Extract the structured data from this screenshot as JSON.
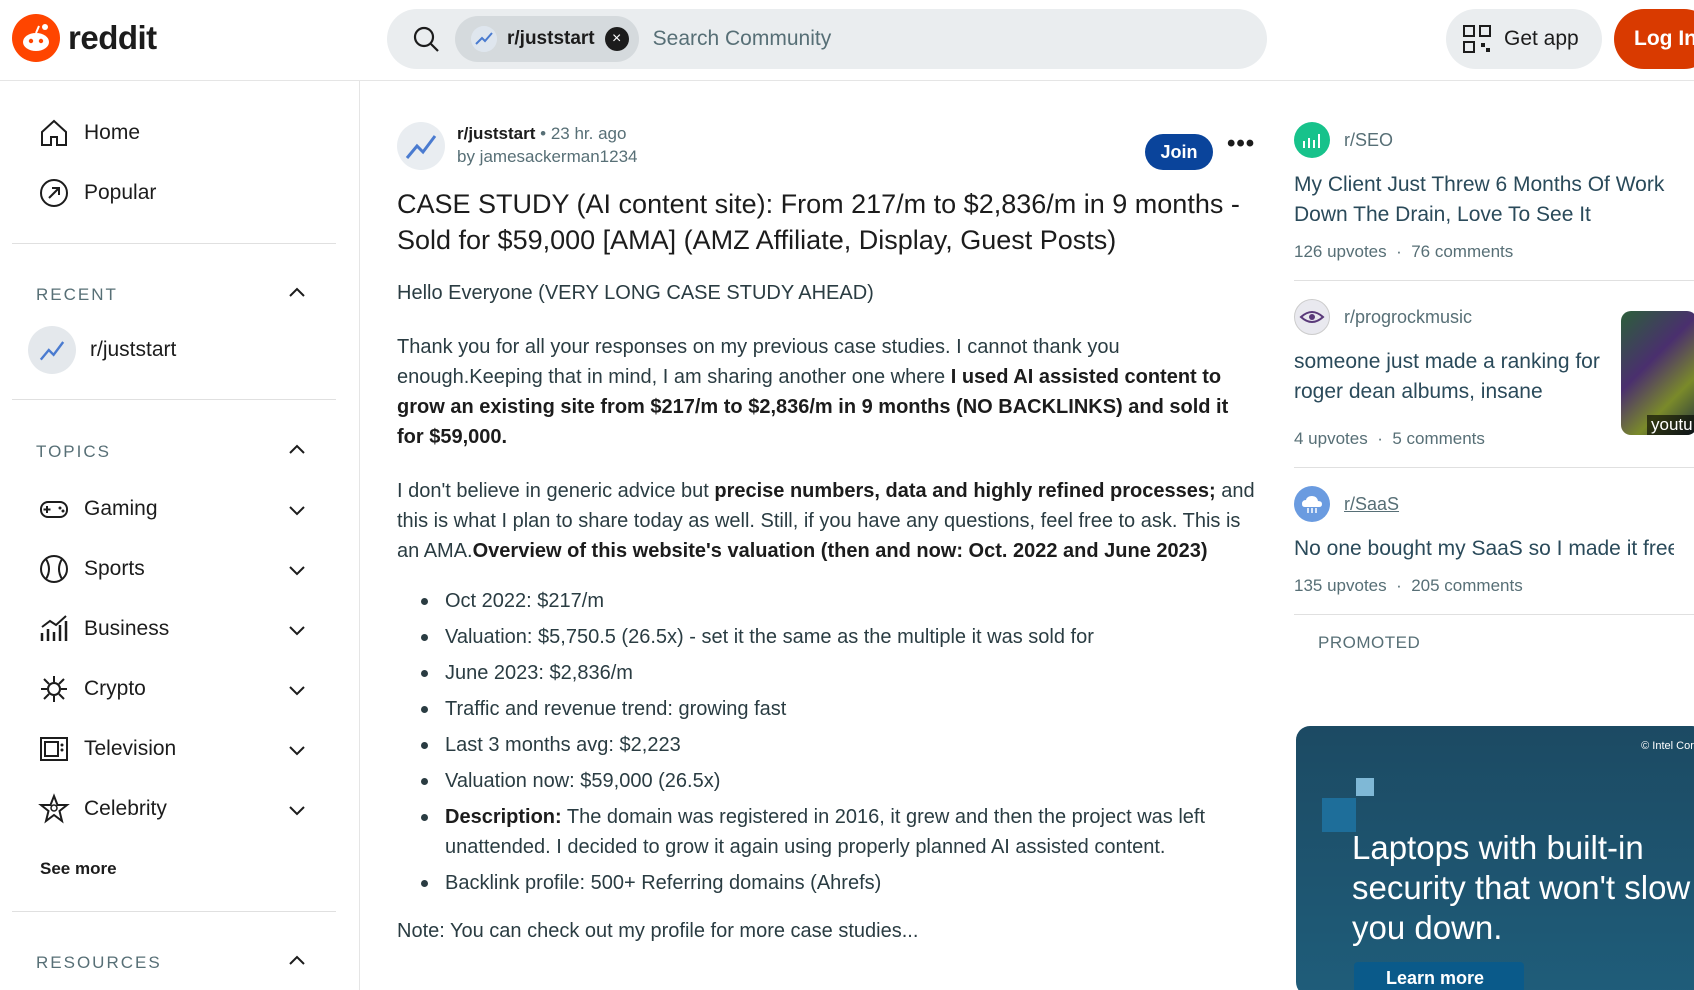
{
  "header": {
    "logo_text": "reddit",
    "search": {
      "chip_label": "r/juststart",
      "placeholder": "Search Community"
    },
    "get_app_label": "Get app",
    "login_label": "Log In"
  },
  "sidebar": {
    "nav": [
      {
        "label": "Home",
        "icon": "home-icon"
      },
      {
        "label": "Popular",
        "icon": "popular-icon"
      }
    ],
    "recent": {
      "title": "RECENT",
      "items": [
        {
          "label": "r/juststart"
        }
      ]
    },
    "topics": {
      "title": "TOPICS",
      "items": [
        {
          "label": "Gaming",
          "icon": "gamepad-icon"
        },
        {
          "label": "Sports",
          "icon": "sports-icon"
        },
        {
          "label": "Business",
          "icon": "business-chart-icon"
        },
        {
          "label": "Crypto",
          "icon": "crypto-icon"
        },
        {
          "label": "Television",
          "icon": "television-icon"
        },
        {
          "label": "Celebrity",
          "icon": "celebrity-star-icon"
        }
      ],
      "see_more": "See more"
    },
    "resources": {
      "title": "RESOURCES"
    }
  },
  "post": {
    "subreddit": "r/juststart",
    "time": "• 23 hr. ago",
    "author": "by jamesackerman1234",
    "join_label": "Join",
    "more_label": "•••",
    "title": "CASE STUDY (AI content site): From 217/m to $2,836/m in 9 months - Sold for $59,000 [AMA] (AMZ Affiliate, Display, Guest Posts)",
    "intro": "Hello Everyone (VERY LONG CASE STUDY AHEAD)",
    "p1_plain": "Thank you for all your responses on my previous case studies. I cannot thank you enough.Keeping that in mind, I am sharing another one where ",
    "p1_bold": "I used AI assisted content to grow an existing site from $217/m to $2,836/m in 9 months (NO BACKLINKS) and sold it for $59,000.",
    "p2_plain1": "I don't believe in generic advice but ",
    "p2_bold1": "precise numbers, data and highly refined processes;",
    "p2_plain2": " and this is what I plan to share today as well. Still, if you have any questions, feel free to ask. This is an AMA.",
    "p2_bold2": "Overview of this website's valuation (then and now: Oct. 2022 and June 2023)",
    "bullets": [
      "Oct 2022: $217/m",
      "Valuation: $5,750.5 (26.5x) - set it the same as the multiple it was sold for",
      "June 2023: $2,836/m",
      "Traffic and revenue trend: growing fast",
      "Last 3 months avg: $2,223",
      "Valuation now: $59,000 (26.5x)"
    ],
    "desc_label": "Description:",
    "desc_text": " The domain was registered in 2016, it grew and then the project was left unattended. I decided to grow it again using properly planned AI assisted content.",
    "backlink": "Backlink profile: 500+ Referring domains (Ahrefs)",
    "note": "Note: You can check out my profile for more case studies..."
  },
  "right": {
    "cards": [
      {
        "sub": "r/SEO",
        "title": "My Client Just Threw 6 Months Of Work Down The Drain, Love To See It",
        "upvotes": "126 upvotes",
        "comments": "76 comments",
        "color": "#17c28b"
      },
      {
        "sub": "r/progrockmusic",
        "title": "someone just made a ranking for roger dean albums, insane",
        "upvotes": "4 upvotes",
        "comments": "5 comments",
        "thumb_label": "youtu"
      },
      {
        "sub": "r/SaaS",
        "title": "No one bought my SaaS so I made it free & public",
        "upvotes": "135 upvotes",
        "comments": "205 comments",
        "color": "#6a9be0"
      }
    ],
    "stat_sep": "·",
    "promoted_label": "PROMOTED",
    "ad": {
      "brand": "© Intel Corp",
      "text": "Laptops with built-in security that won't slow you down.",
      "button": "Learn more"
    }
  }
}
